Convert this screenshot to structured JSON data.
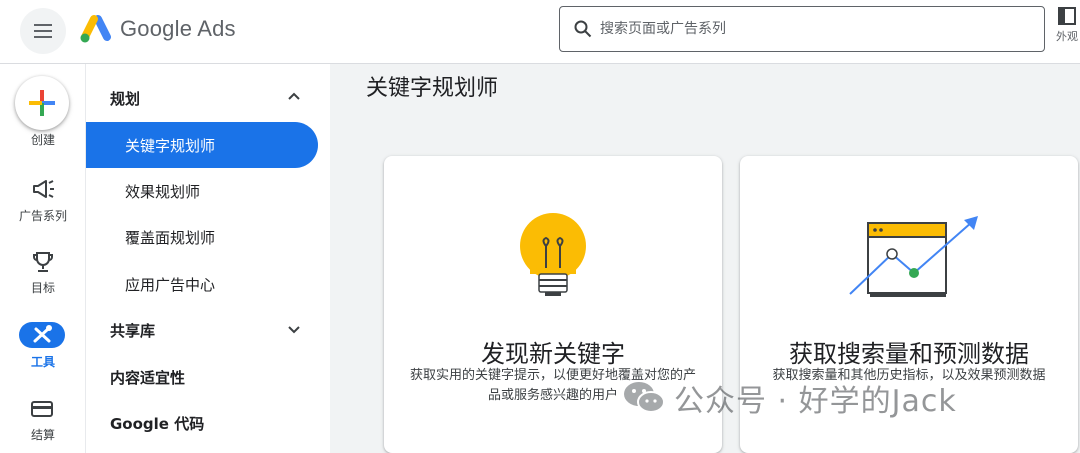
{
  "header": {
    "brand": "Google Ads",
    "search_placeholder": "搜索页面或广告系列",
    "appearance_label": "外观"
  },
  "rail": {
    "create_label": "创建",
    "campaigns_label": "广告系列",
    "goals_label": "目标",
    "tools_label": "工具",
    "billing_label": "结算"
  },
  "nav": {
    "planning": "规划",
    "keyword_planner": "关键字规划师",
    "performance_planner": "效果规划师",
    "reach_planner": "覆盖面规划师",
    "app_ads_hub": "应用广告中心",
    "shared_library": "共享库",
    "content_suitability": "内容适宜性",
    "google_tag": "Google 代码"
  },
  "main": {
    "title": "关键字规划师",
    "cards": [
      {
        "title": "发现新关键字",
        "desc": "获取实用的关键字提示，以便更好地覆盖对您的产品或服务感兴趣的用户"
      },
      {
        "title": "获取搜索量和预测数据",
        "desc": "获取搜索量和其他历史指标，以及效果预测数据"
      }
    ]
  },
  "watermark": "公众号 · 好学的Jack",
  "colors": {
    "accent": "#1a73e8",
    "bulb": "#fbbc04",
    "google_red": "#ea4335",
    "google_green": "#34a853"
  }
}
